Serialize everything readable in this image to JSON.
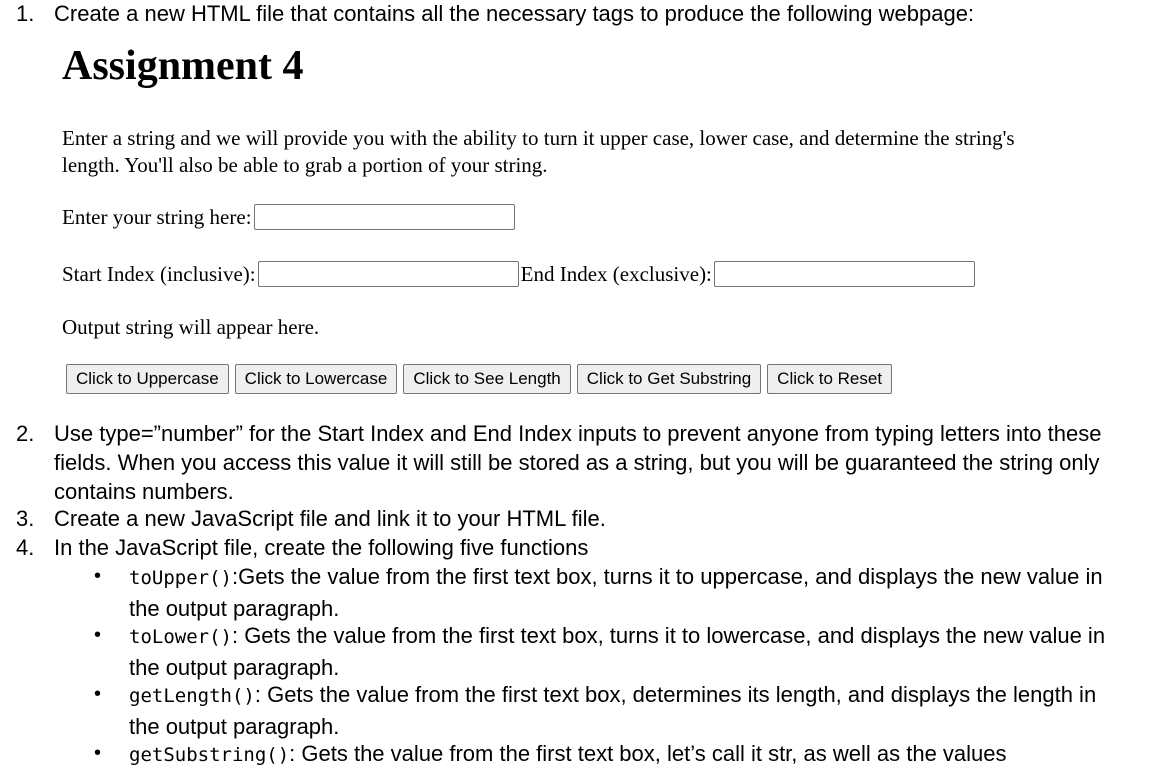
{
  "steps": [
    {
      "num": "1.",
      "text": "Create a new HTML file that contains all the necessary tags to produce the following webpage:"
    },
    {
      "num": "2.",
      "text": "Use type=”number” for the Start Index and End Index inputs to prevent anyone from typing letters into these fields. When you access this value it will still be stored as a string, but you will be guaranteed the string only contains numbers."
    },
    {
      "num": "3.",
      "text": "Create a new JavaScript file and link it to your HTML file."
    },
    {
      "num": "4.",
      "text": "In the JavaScript file, create the following five functions"
    }
  ],
  "demo": {
    "title": "Assignment 4",
    "intro": "Enter a string and we will provide you with the ability to turn it upper case, lower case, and determine the string's length. You'll also be able to grab a portion of your string.",
    "string_label": "Enter your string here:",
    "string_value": "",
    "start_label": "Start Index (inclusive):",
    "start_value": "",
    "end_label": "End Index (exclusive):",
    "end_value": "",
    "output": "Output string will appear here.",
    "buttons": [
      "Click to Uppercase",
      "Click to Lowercase",
      "Click to See Length",
      "Click to Get Substring",
      "Click to Reset"
    ]
  },
  "functions": [
    {
      "name": "toUpper()",
      "sep": ":",
      "desc": "Gets the value from the first text box, turns it to uppercase, and displays the new value in the output paragraph."
    },
    {
      "name": "toLower()",
      "sep": ": ",
      "desc": "Gets the value from the first text box, turns it to lowercase, and displays the new value in the output paragraph."
    },
    {
      "name": "getLength()",
      "sep": ": ",
      "desc": "Gets the value from the first text box, determines its length, and displays the length in the output paragraph."
    },
    {
      "name": "getSubstring()",
      "sep": ": ",
      "desc": "Gets the value from the first text box, let’s call it str, as well as the values"
    }
  ]
}
